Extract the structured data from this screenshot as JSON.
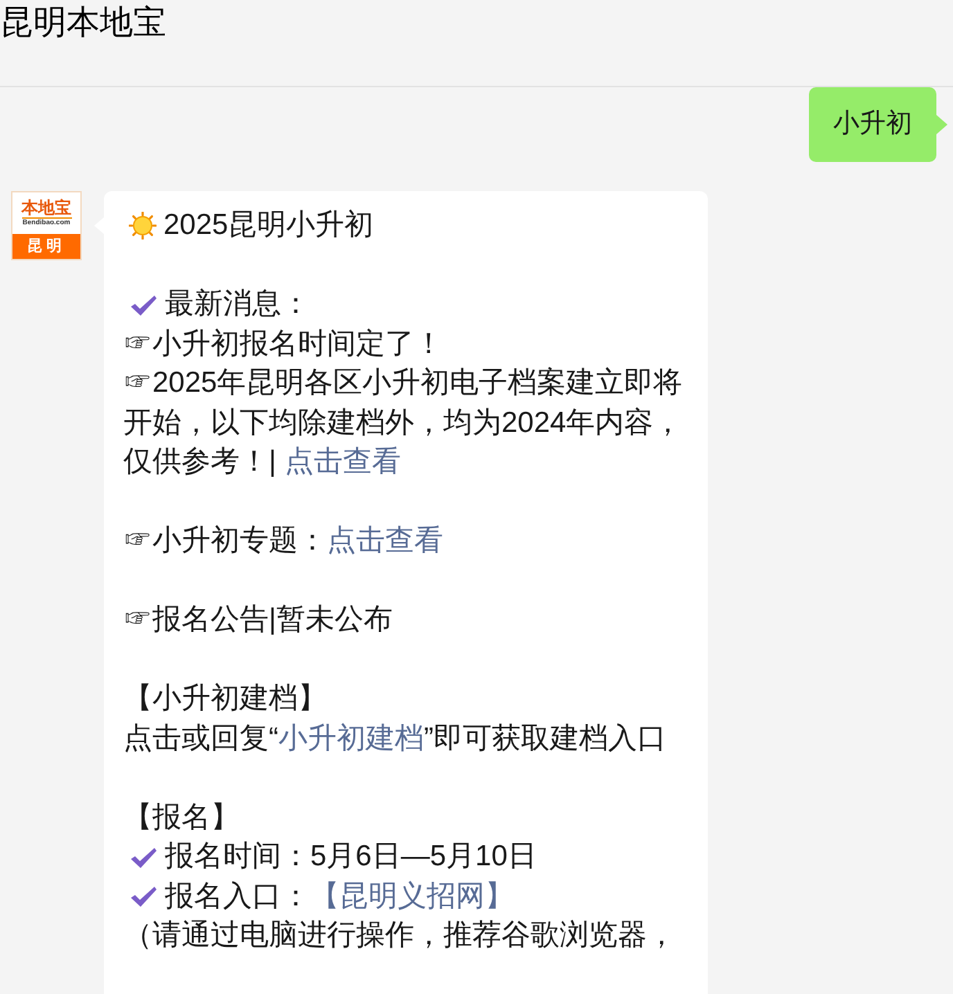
{
  "header": {
    "title": "昆明本地宝"
  },
  "outgoing": {
    "text": "小升初"
  },
  "incoming": {
    "avatar": {
      "brand": "本地宝",
      "site": "Bendibao.com",
      "city": "昆明"
    },
    "blocks": [
      {
        "lines": [
          {
            "kind": "heading",
            "segments": [
              {
                "kind": "text",
                "text": "2025昆明小升初"
              }
            ]
          }
        ]
      },
      {
        "lines": [
          {
            "kind": "check",
            "segments": [
              {
                "kind": "text",
                "text": "最新消息："
              }
            ]
          },
          {
            "kind": "plain",
            "segments": [
              {
                "kind": "text",
                "text": "☞小升初报名时间定了！"
              }
            ]
          },
          {
            "kind": "plain",
            "segments": [
              {
                "kind": "text",
                "text": "☞2025年昆明各区小升初电子档案建立即将开始，以下均除建档外，均为2024年内容，仅供参考！| "
              },
              {
                "kind": "link",
                "text": "点击查看"
              }
            ]
          }
        ]
      },
      {
        "lines": [
          {
            "kind": "plain",
            "segments": [
              {
                "kind": "text",
                "text": "☞小升初专题："
              },
              {
                "kind": "link",
                "text": "点击查看"
              }
            ]
          }
        ]
      },
      {
        "lines": [
          {
            "kind": "plain",
            "segments": [
              {
                "kind": "text",
                "text": "☞报名公告|暂未公布"
              }
            ]
          }
        ]
      },
      {
        "lines": [
          {
            "kind": "plain",
            "segments": [
              {
                "kind": "text",
                "text": "【小升初建档】"
              }
            ]
          },
          {
            "kind": "plain",
            "segments": [
              {
                "kind": "text",
                "text": "点击或回复“"
              },
              {
                "kind": "link",
                "text": "小升初建档"
              },
              {
                "kind": "text",
                "text": "”即可获取建档入口"
              }
            ]
          }
        ]
      },
      {
        "lines": [
          {
            "kind": "plain",
            "segments": [
              {
                "kind": "text",
                "text": "【报名】"
              }
            ]
          },
          {
            "kind": "check",
            "segments": [
              {
                "kind": "text",
                "text": "报名时间：5月6日—5月10日"
              }
            ]
          },
          {
            "kind": "check",
            "segments": [
              {
                "kind": "text",
                "text": "报名入口："
              },
              {
                "kind": "link",
                "text": "【昆明义招网】"
              }
            ]
          },
          {
            "kind": "plain",
            "segments": [
              {
                "kind": "text",
                "text": "（请通过电脑进行操作，推荐谷歌浏览器，"
              }
            ]
          }
        ]
      }
    ]
  }
}
